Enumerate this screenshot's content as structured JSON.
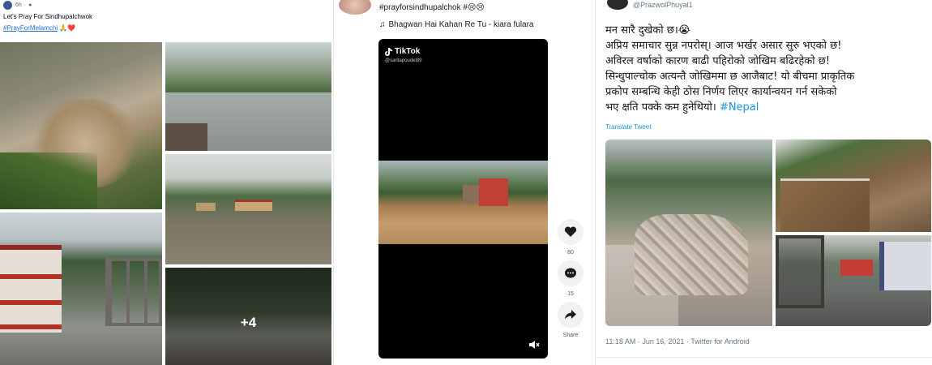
{
  "facebook_post": {
    "meta": "6h · ",
    "text": "Let's Pray For Sindhupalchwok",
    "hashtag": "#PrayForMelamchi",
    "emoji": "🙏❤️",
    "more_photos_label": "+4"
  },
  "tiktok_post": {
    "caption": "#prayforsindhupalchok #😢😢",
    "music_icon": "♫",
    "music": "Bhagwan Hai Kahan Re Tu - kiara fulara",
    "logo_text": "TikTok",
    "username": "@saritapoudel89",
    "likes": "80",
    "comments": "15",
    "share_label": "Share",
    "icons": {
      "like": "heart-icon",
      "comment": "comment-icon",
      "share": "share-icon",
      "mute": "mute-icon"
    }
  },
  "twitter_post": {
    "handle": "@PrazwolPhuyal1",
    "lines": [
      "मन सारै दुखेको छ।😭",
      "अप्रिय समाचार सुन्न नपरोस्। आज भर्खर असार सुरु भएको छ!",
      "अविरल वर्षाको कारण बाढी पहिरोको जोखिम बढिरहेको छ!",
      "सिन्धुपाल्चोक अत्यन्तै जोखिममा छ आजैबाट! यो बीचमा प्राकृतिक",
      "प्रकोप सम्बन्धि केही ठोस निर्णय लिएर कार्यान्वयन गर्न सकेको",
      "भए क्षति पक्के कम हुनेथियो।"
    ],
    "hashtag": "#Nepal",
    "translate": "Translate Tweet",
    "timestamp": "11:18 AM · Jun 16, 2021 · Twitter for Android",
    "accent_color": "#1b95e0"
  }
}
